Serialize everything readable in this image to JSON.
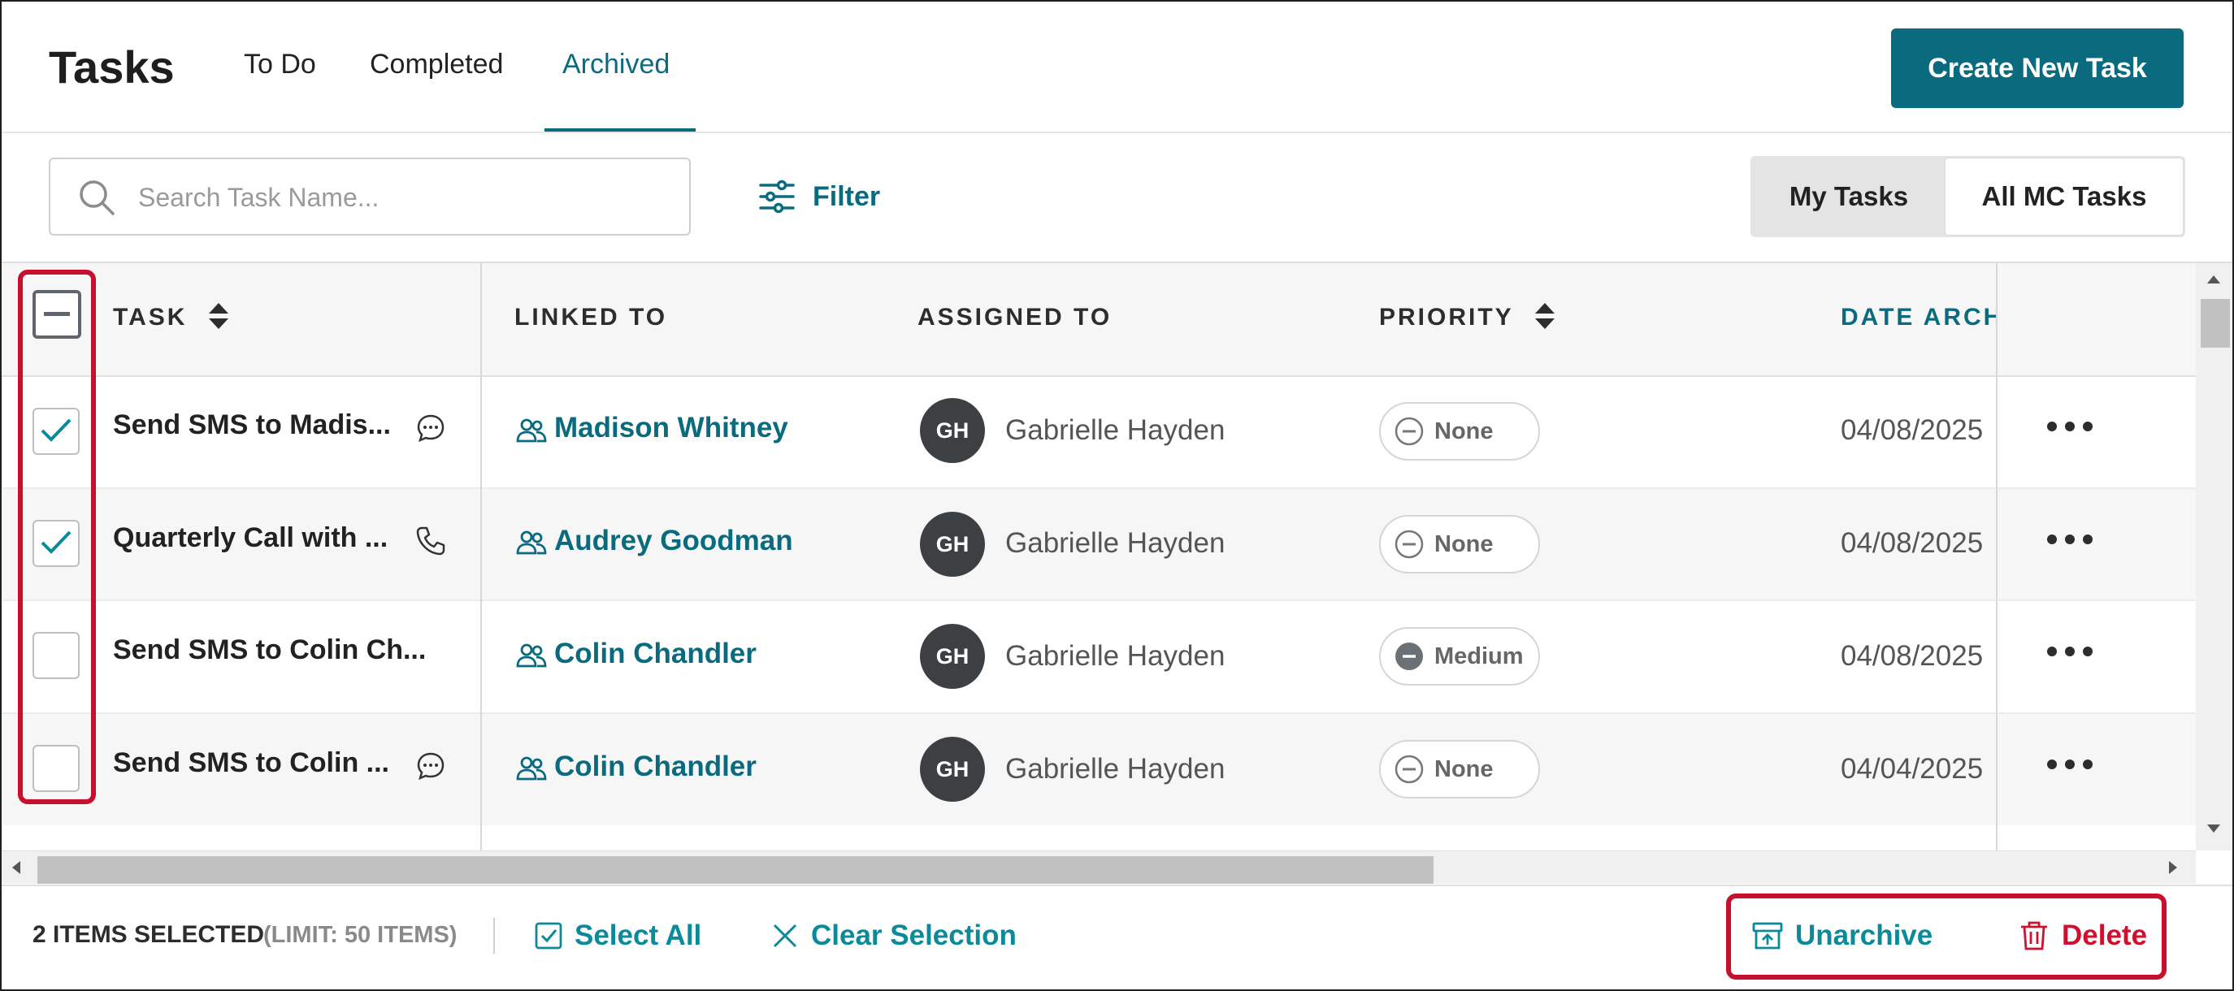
{
  "header": {
    "title": "Tasks",
    "tabs": [
      {
        "label": "To Do",
        "active": false
      },
      {
        "label": "Completed",
        "active": false
      },
      {
        "label": "Archived",
        "active": true
      }
    ],
    "create_button": "Create New Task"
  },
  "toolbar": {
    "search_placeholder": "Search Task Name...",
    "filter_label": "Filter",
    "segment": {
      "my_tasks": "My Tasks",
      "all_tasks": "All MC Tasks",
      "selected": "All MC Tasks"
    }
  },
  "table": {
    "columns": {
      "task": "TASK",
      "linked_to": "LINKED TO",
      "assigned_to": "ASSIGNED TO",
      "priority": "PRIORITY",
      "date_archived": "DATE ARCH"
    },
    "rows": [
      {
        "checked": true,
        "task": "Send SMS to Madis...",
        "task_icon": "chat-bubble-icon",
        "linked_to": "Madison Whitney",
        "assignee_initials": "GH",
        "assignee": "Gabrielle Hayden",
        "priority": "None",
        "date": "04/08/2025"
      },
      {
        "checked": true,
        "task": "Quarterly Call with ...",
        "task_icon": "phone-icon",
        "linked_to": "Audrey Goodman",
        "assignee_initials": "GH",
        "assignee": "Gabrielle Hayden",
        "priority": "None",
        "date": "04/08/2025"
      },
      {
        "checked": false,
        "task": "Send SMS to Colin Ch...",
        "task_icon": "",
        "linked_to": "Colin Chandler",
        "assignee_initials": "GH",
        "assignee": "Gabrielle Hayden",
        "priority": "Medium",
        "date": "04/08/2025"
      },
      {
        "checked": false,
        "task": "Send SMS to Colin ...",
        "task_icon": "chat-bubble-icon",
        "linked_to": "Colin Chandler",
        "assignee_initials": "GH",
        "assignee": "Gabrielle Hayden",
        "priority": "None",
        "date": "04/04/2025"
      }
    ]
  },
  "footer": {
    "selected_count": "2 ITEMS SELECTED",
    "limit": "(LIMIT: 50 ITEMS)",
    "select_all": "Select All",
    "clear_selection": "Clear Selection",
    "unarchive": "Unarchive",
    "delete": "Delete"
  },
  "colors": {
    "accent": "#0b6b7e",
    "danger": "#d0102e",
    "highlight": "#c8102e"
  }
}
